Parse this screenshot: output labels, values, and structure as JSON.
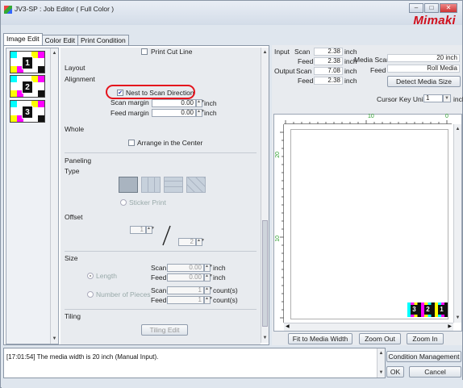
{
  "window": {
    "title": "JV3-SP : Job Editor ( Full Color )",
    "logo": "Mimaki",
    "min": "–",
    "max": "□",
    "close": "✕"
  },
  "tabs": [
    {
      "label": "Image Edit"
    },
    {
      "label": "Color Edit"
    },
    {
      "label": "Print Condition"
    }
  ],
  "thumbnails": [
    {
      "number": "1"
    },
    {
      "number": "2"
    },
    {
      "number": "3"
    }
  ],
  "layout": {
    "print_cut_line": "Print Cut Line",
    "section": "Layout",
    "alignment": "Alignment",
    "nest_label": "Nest to Scan Direction",
    "nest_checked": true,
    "scan_margin_label": "Scan margin",
    "scan_margin_value": "0.00",
    "feed_margin_label": "Feed margin",
    "feed_margin_value": "0.00",
    "unit": "inch",
    "whole": "Whole",
    "arrange_center": "Arrange in the Center"
  },
  "paneling": {
    "section": "Paneling",
    "type": "Type",
    "sticker_print": "Sticker Print",
    "offset": "Offset",
    "offset_x": "1",
    "offset_y": "2"
  },
  "size": {
    "section": "Size",
    "length_label": "Length",
    "scan": "Scan",
    "feed": "Feed",
    "length_scan_value": "0.00",
    "length_feed_value": "0.00",
    "inch": "inch",
    "pieces_label": "Number of Pieces",
    "pieces_scan_value": "1",
    "pieces_feed_value": "1",
    "counts": "count(s)"
  },
  "tiling": {
    "section": "Tiling",
    "edit_button": "Tiling Edit"
  },
  "info": {
    "input": "Input",
    "output": "Output",
    "scan": "Scan",
    "feed": "Feed",
    "input_scan": "2.38",
    "input_feed": "2.38",
    "output_scan": "7.08",
    "output_feed": "2.38",
    "inch": "inch",
    "media_scan_label": "Media Scan",
    "media_scan_value": "20 inch",
    "media_feed_label": "Feed",
    "media_feed_value": "Roll Media",
    "detect_button": "Detect Media Size",
    "cursor_key_unit_label": "Cursor Key Unit",
    "cursor_key_unit_value": "1",
    "cursor_unit": "inch"
  },
  "ruler": {
    "h": [
      "10",
      "0"
    ],
    "v": [
      "20",
      "10"
    ]
  },
  "preview_labels": [
    "3",
    "2",
    "1"
  ],
  "view_buttons": {
    "fit": "Fit to Media Width",
    "zoom_out": "Zoom Out",
    "zoom_in": "Zoom In"
  },
  "log": {
    "message": "[17:01:54] The media width is 20 inch (Manual Input)."
  },
  "dialog_buttons": {
    "condition": "Condition Management",
    "ok": "OK",
    "cancel": "Cancel"
  }
}
